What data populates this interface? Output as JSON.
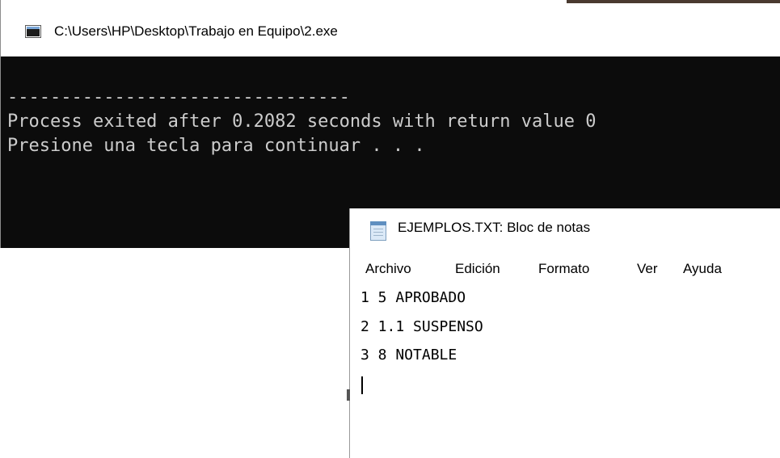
{
  "console": {
    "title": "C:\\Users\\HP\\Desktop\\Trabajo en Equipo\\2.exe",
    "icon": "console-app-icon",
    "lines": [
      "--------------------------------",
      "Process exited after 0.2082 seconds with return value 0",
      "Presione una tecla para continuar . . ."
    ]
  },
  "notepad": {
    "title": "EJEMPLOS.TXT: Bloc de notas",
    "icon": "notepad-icon",
    "menu": [
      "Archivo",
      "Edición",
      "Formato",
      "Ver",
      "Ayuda"
    ],
    "lines": [
      "1 5 APROBADO",
      "2 1.1 SUSPENSO",
      "3 8 NOTABLE"
    ]
  }
}
